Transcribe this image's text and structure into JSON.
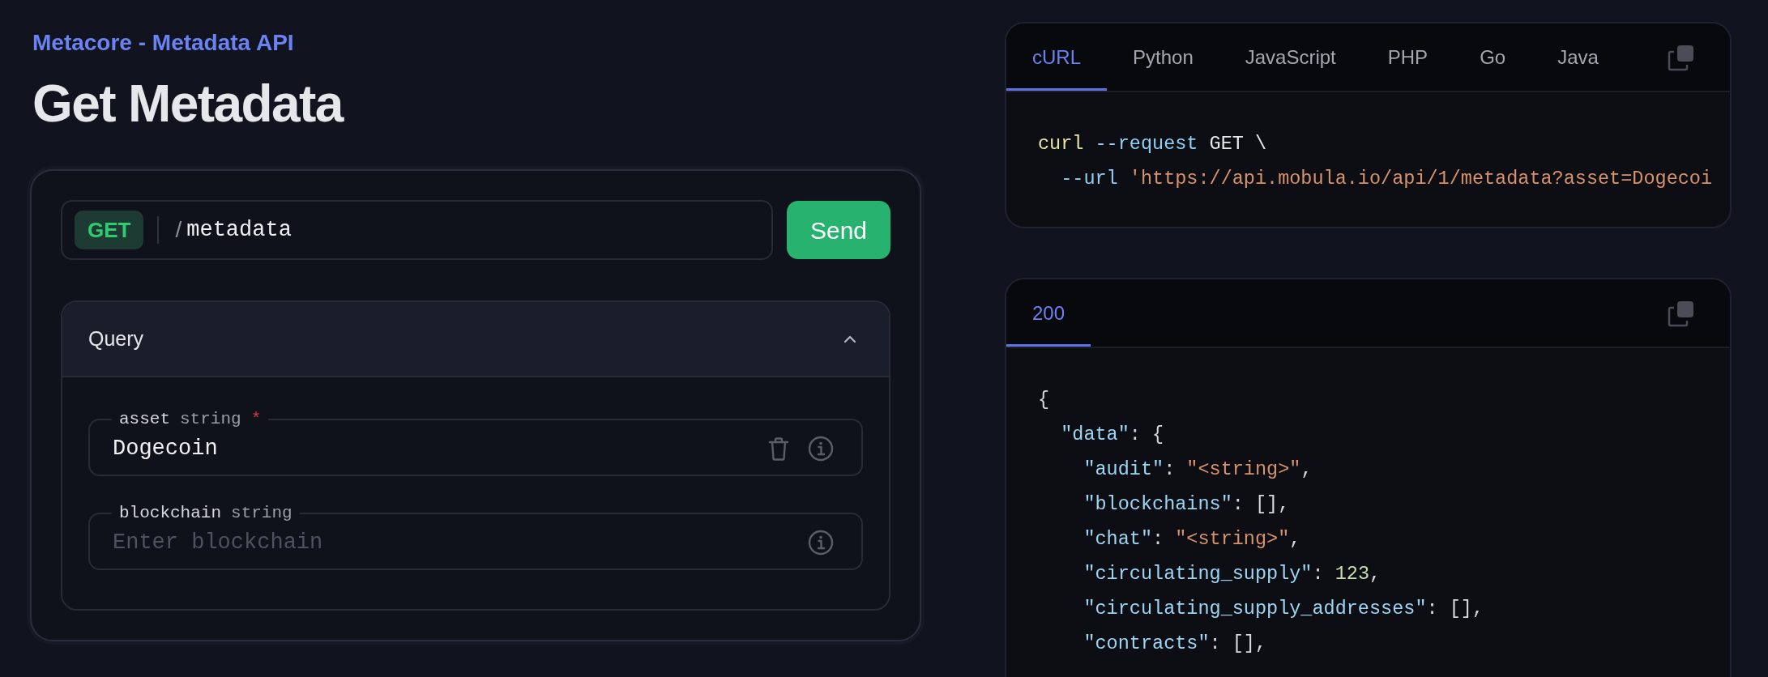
{
  "breadcrumb": "Metacore - Metadata API",
  "title": "Get Metadata",
  "request": {
    "method": "GET",
    "separator": "/",
    "path": "metadata",
    "send": "Send"
  },
  "query": {
    "title": "Query",
    "expanded": true,
    "params": [
      {
        "name": "asset",
        "type": "string",
        "required_mark": "*",
        "value": "Dogecoin"
      },
      {
        "name": "blockchain",
        "type": "string",
        "placeholder": "Enter blockchain"
      }
    ]
  },
  "code_sample": {
    "tabs": [
      {
        "label": "cURL",
        "selected": true
      },
      {
        "label": "Python",
        "selected": false
      },
      {
        "label": "JavaScript",
        "selected": false
      },
      {
        "label": "PHP",
        "selected": false
      },
      {
        "label": "Go",
        "selected": false
      },
      {
        "label": "Java",
        "selected": false
      }
    ],
    "lines": [
      [
        {
          "text": "curl ",
          "kind": "command"
        },
        {
          "text": "--request",
          "kind": "flag"
        },
        {
          "text": " GET \\",
          "kind": "plain"
        }
      ],
      [
        {
          "text": "  --url ",
          "kind": "flag"
        },
        {
          "text": "'https://api.mobula.io/api/1/metadata?asset=Dogecoi",
          "kind": "string"
        }
      ]
    ]
  },
  "response": {
    "tabs": [
      {
        "label": "200",
        "selected": true
      }
    ],
    "lines": [
      [
        {
          "text": "{",
          "kind": "punct"
        }
      ],
      [
        {
          "text": "  \"data\"",
          "kind": "key"
        },
        {
          "text": ": {",
          "kind": "punct"
        }
      ],
      [
        {
          "text": "    \"audit\"",
          "kind": "key"
        },
        {
          "text": ": ",
          "kind": "punct"
        },
        {
          "text": "\"<string>\"",
          "kind": "string"
        },
        {
          "text": ",",
          "kind": "punct"
        }
      ],
      [
        {
          "text": "    \"blockchains\"",
          "kind": "key"
        },
        {
          "text": ": [],",
          "kind": "punct"
        }
      ],
      [
        {
          "text": "    \"chat\"",
          "kind": "key"
        },
        {
          "text": ": ",
          "kind": "punct"
        },
        {
          "text": "\"<string>\"",
          "kind": "string"
        },
        {
          "text": ",",
          "kind": "punct"
        }
      ],
      [
        {
          "text": "    \"circulating_supply\"",
          "kind": "key"
        },
        {
          "text": ": ",
          "kind": "punct"
        },
        {
          "text": "123",
          "kind": "number"
        },
        {
          "text": ",",
          "kind": "punct"
        }
      ],
      [
        {
          "text": "    \"circulating_supply_addresses\"",
          "kind": "key"
        },
        {
          "text": ": [],",
          "kind": "punct"
        }
      ],
      [
        {
          "text": "    \"contracts\"",
          "kind": "key"
        },
        {
          "text": ": [],",
          "kind": "punct"
        }
      ]
    ]
  }
}
